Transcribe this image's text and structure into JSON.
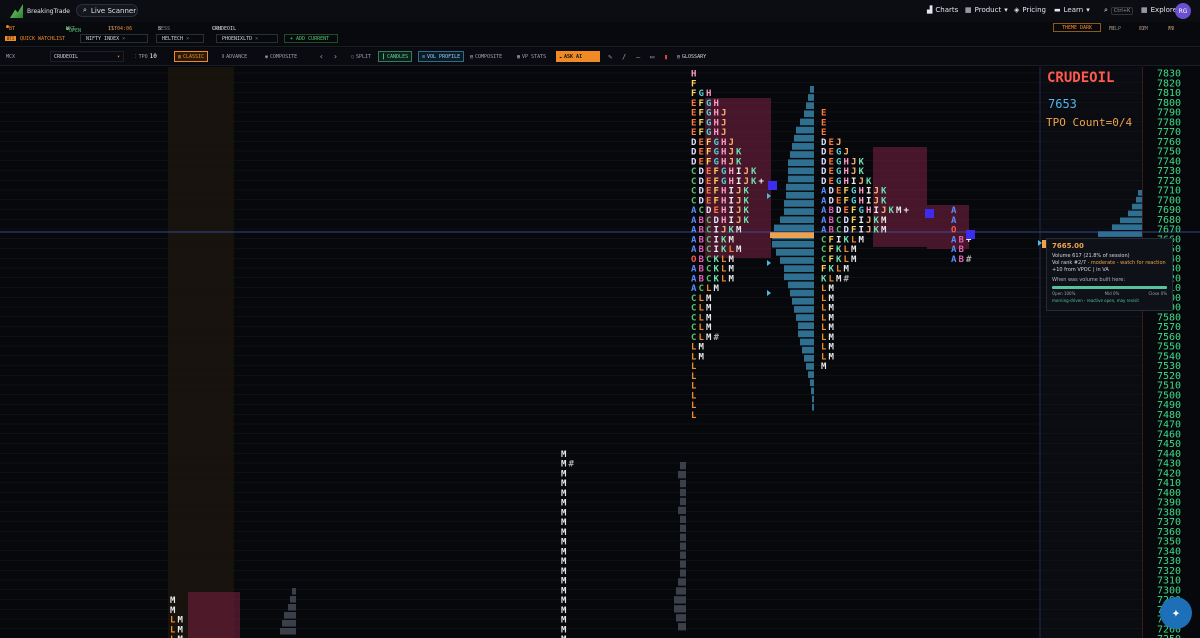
{
  "app": {
    "brand": "BreakingTrade",
    "search_label": "Live Scanner"
  },
  "nav": {
    "charts": "Charts",
    "product": "Product",
    "pricing": "Pricing",
    "learn": "Learn",
    "shortcut": "Ctrl+K",
    "explore": "Explore",
    "avatar": "RG"
  },
  "status": {
    "terminal": "BT TERMINAL",
    "mkt_label": "MKT",
    "mkt_value": "OPEN",
    "ist_label": "IST",
    "ist_value": "11:04:06",
    "sess_label": "SESS",
    "sess_value": "8 (11:00)",
    "sym_label": "SYM",
    "sym_value": "CRUDEOIL",
    "theme": "THEME DARK",
    "f1": "F1",
    "f1_label": "HELP",
    "f2": "F2",
    "f2_label": "SYM",
    "f9": "F9",
    "f9_label": "AI"
  },
  "watchlist": {
    "tag": "BTI",
    "label": "QUICK WATCHLIST",
    "items": [
      "NIFTY INDEX",
      "HELTECH",
      "PHOENIXLTD"
    ],
    "add": "ADD CURRENT"
  },
  "toolbar": {
    "exchange": "MCX",
    "symbol": "CRUDEOIL",
    "tpo_label": "TPO",
    "tpo_value": "10",
    "classic": "CLASSIC",
    "advance": "ADVANCE",
    "composite": "COMPOSITE",
    "split": "SPLIT",
    "candles": "CANDLES",
    "vol_profile": "VOL PROFILE",
    "composite2": "COMPOSITE",
    "vp_stats": "VP STATS",
    "ask_ai": "ASK AI",
    "glossary": "GLOSSARY"
  },
  "overlay": {
    "symbol": "CRUDEOIL",
    "price": "7653",
    "tpo_count": "TPO Count=0/4"
  },
  "tooltip": {
    "price": "7665.00",
    "volume": "Volume 617 (21.8% of session)",
    "rank_prefix": "Vol rank #2/7 · ",
    "rank_note": "moderate - watch for reaction",
    "vpoc": "+10 from VPOC | in VA",
    "built_label": "When was volume built here:",
    "open": "Open 100%",
    "mid": "Mid 0%",
    "close": "Close 0%",
    "foot": "morning-driven - reactive open, may revisit"
  },
  "colors": {
    "accent": "#f08a24",
    "price_up": "#3ddc84",
    "value_area": "#6b1f3a",
    "volume_bar": "#2f6f8f",
    "poc": "#f0a24a",
    "crosshair": "#3a5fb8"
  },
  "chart_data": {
    "type": "table",
    "price_axis": {
      "min": 7250,
      "max": 7830,
      "step": 10
    },
    "profiles": [
      {
        "rows": [
          {
            "price": 7830,
            "letters": "H"
          },
          {
            "price": 7820,
            "letters": "F"
          },
          {
            "price": 7810,
            "letters": "FGH"
          },
          {
            "price": 7800,
            "letters": "EFGH"
          },
          {
            "price": 7790,
            "letters": "EFGHJ"
          },
          {
            "price": 7780,
            "letters": "EFGHJ"
          },
          {
            "price": 7770,
            "letters": "EFGHJ"
          },
          {
            "price": 7760,
            "letters": "DEFGHJ"
          },
          {
            "price": 7750,
            "letters": "DEFGHJK"
          },
          {
            "price": 7740,
            "letters": "DEFGHJK"
          },
          {
            "price": 7730,
            "letters": "CDEFGHIJK"
          },
          {
            "price": 7720,
            "letters": "CDEFGHIJK+"
          },
          {
            "price": 7710,
            "letters": "CDEFHIJK"
          },
          {
            "price": 7700,
            "letters": "CDEFHIJK"
          },
          {
            "price": 7690,
            "letters": "ACDEHIJK"
          },
          {
            "price": 7680,
            "letters": "ABCDHIJK"
          },
          {
            "price": 7670,
            "letters": "ABCIJKM"
          },
          {
            "price": 7660,
            "letters": "ABCIKM"
          },
          {
            "price": 7650,
            "letters": "ABCIKLM"
          },
          {
            "price": 7640,
            "letters": "OBCKLM"
          },
          {
            "price": 7630,
            "letters": "ABCKLM"
          },
          {
            "price": 7620,
            "letters": "ABCKLM"
          },
          {
            "price": 7610,
            "letters": "ACLM"
          },
          {
            "price": 7600,
            "letters": "CLM"
          },
          {
            "price": 7590,
            "letters": "CLM"
          },
          {
            "price": 7580,
            "letters": "CLM"
          },
          {
            "price": 7570,
            "letters": "CLM"
          },
          {
            "price": 7560,
            "letters": "CLM#"
          },
          {
            "price": 7550,
            "letters": "LM"
          },
          {
            "price": 7540,
            "letters": "LM"
          },
          {
            "price": 7530,
            "letters": "L"
          },
          {
            "price": 7520,
            "letters": "L"
          },
          {
            "price": 7510,
            "letters": "L"
          },
          {
            "price": 7500,
            "letters": "L"
          },
          {
            "price": 7490,
            "letters": "L"
          },
          {
            "price": 7480,
            "letters": "L"
          }
        ]
      },
      {
        "rows": [
          {
            "price": 7790,
            "letters": "E"
          },
          {
            "price": 7780,
            "letters": "E"
          },
          {
            "price": 7770,
            "letters": "E"
          },
          {
            "price": 7760,
            "letters": "DEJ"
          },
          {
            "price": 7750,
            "letters": "DEGJ"
          },
          {
            "price": 7740,
            "letters": "DEGHJK"
          },
          {
            "price": 7730,
            "letters": "DEGHJK"
          },
          {
            "price": 7720,
            "letters": "DEGHIJK"
          },
          {
            "price": 7710,
            "letters": "ADEFGHIJK"
          },
          {
            "price": 7700,
            "letters": "ADEFGHIJK"
          },
          {
            "price": 7690,
            "letters": "ABDEFGHIJKM+"
          },
          {
            "price": 7680,
            "letters": "ABCDFIJKM"
          },
          {
            "price": 7670,
            "letters": "ABCDFIJKM"
          },
          {
            "price": 7660,
            "letters": "CFIKLM"
          },
          {
            "price": 7650,
            "letters": "CFKLM"
          },
          {
            "price": 7640,
            "letters": "CFKLM"
          },
          {
            "price": 7630,
            "letters": "FKLM"
          },
          {
            "price": 7620,
            "letters": "KLM#"
          },
          {
            "price": 7610,
            "letters": "LM"
          },
          {
            "price": 7600,
            "letters": "LM"
          },
          {
            "price": 7590,
            "letters": "LM"
          },
          {
            "price": 7580,
            "letters": "LM"
          },
          {
            "price": 7570,
            "letters": "LM"
          },
          {
            "price": 7560,
            "letters": "LM"
          },
          {
            "price": 7550,
            "letters": "LM"
          },
          {
            "price": 7540,
            "letters": "LM"
          },
          {
            "price": 7530,
            "letters": "M"
          }
        ]
      },
      {
        "rows": [
          {
            "price": 7690,
            "letters": "A"
          },
          {
            "price": 7680,
            "letters": "A"
          },
          {
            "price": 7670,
            "letters": "O"
          },
          {
            "price": 7660,
            "letters": "AB+"
          },
          {
            "price": 7650,
            "letters": "AB"
          },
          {
            "price": 7640,
            "letters": "AB#"
          }
        ]
      },
      {
        "rows": [
          {
            "price": 7440,
            "letters": "M"
          },
          {
            "price": 7430,
            "letters": "M#"
          },
          {
            "price": 7420,
            "letters": "M"
          },
          {
            "price": 7410,
            "letters": "M"
          },
          {
            "price": 7400,
            "letters": "M"
          },
          {
            "price": 7390,
            "letters": "M"
          },
          {
            "price": 7380,
            "letters": "M"
          },
          {
            "price": 7370,
            "letters": "M"
          },
          {
            "price": 7360,
            "letters": "M"
          },
          {
            "price": 7350,
            "letters": "M"
          },
          {
            "price": 7340,
            "letters": "M"
          },
          {
            "price": 7330,
            "letters": "M"
          },
          {
            "price": 7320,
            "letters": "M"
          },
          {
            "price": 7310,
            "letters": "M"
          },
          {
            "price": 7300,
            "letters": "M"
          },
          {
            "price": 7290,
            "letters": "M"
          },
          {
            "price": 7280,
            "letters": "M"
          },
          {
            "price": 7270,
            "letters": "M"
          },
          {
            "price": 7260,
            "letters": "M"
          },
          {
            "price": 7250,
            "letters": "M"
          }
        ]
      },
      {
        "rows": [
          {
            "price": 7290,
            "letters": "M"
          },
          {
            "price": 7280,
            "letters": "M"
          },
          {
            "price": 7270,
            "letters": "LM"
          },
          {
            "price": 7260,
            "letters": "LM"
          },
          {
            "price": 7250,
            "letters": "LM"
          }
        ]
      }
    ]
  }
}
